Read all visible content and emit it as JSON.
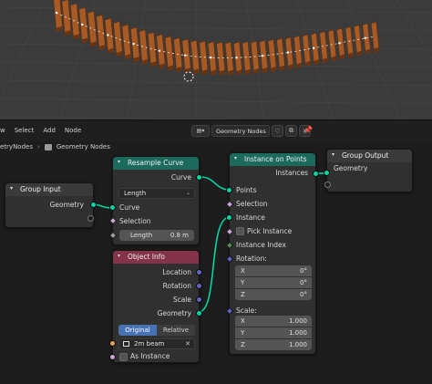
{
  "header": {
    "menu": [
      "w",
      "Select",
      "Add",
      "Node"
    ],
    "tree_name": "Geometry Nodes",
    "pin_icon": "pin-icon"
  },
  "breadcrumb": [
    "etryNodes",
    "Geometry Nodes"
  ],
  "nodes": {
    "group_input": {
      "title": "Group Input",
      "outputs": [
        "Geometry"
      ]
    },
    "resample_curve": {
      "title": "Resample Curve",
      "output": "Curve",
      "mode": "Length",
      "inputs": [
        "Curve",
        "Selection"
      ],
      "length_label": "Length",
      "length_value": "0.8 m"
    },
    "object_info": {
      "title": "Object Info",
      "outputs": [
        "Location",
        "Rotation",
        "Scale",
        "Geometry"
      ],
      "transform_options": [
        "Original",
        "Relative"
      ],
      "selected_option": "Original",
      "object_value": "2m beam",
      "as_instance_label": "As Instance"
    },
    "instance_on_points": {
      "title": "Instance on Points",
      "output": "Instances",
      "inputs": [
        "Points",
        "Selection",
        "Instance",
        "Pick Instance",
        "Instance Index"
      ],
      "rotation_label": "Rotation:",
      "rotation": [
        {
          "axis": "X",
          "value": "0°"
        },
        {
          "axis": "Y",
          "value": "0°"
        },
        {
          "axis": "Z",
          "value": "0°"
        }
      ],
      "scale_label": "Scale:",
      "scale": [
        {
          "axis": "X",
          "value": "1.000"
        },
        {
          "axis": "Y",
          "value": "1.000"
        },
        {
          "axis": "Z",
          "value": "1.000"
        }
      ]
    },
    "group_output": {
      "title": "Group Output",
      "inputs": [
        "Geometry"
      ]
    }
  },
  "colors": {
    "geometry_socket": "#00d6a3",
    "header_geometry": "#1b6a5c",
    "header_input": "#83334a",
    "selected_toggle": "#4772b3",
    "wood": "#a85a25"
  }
}
